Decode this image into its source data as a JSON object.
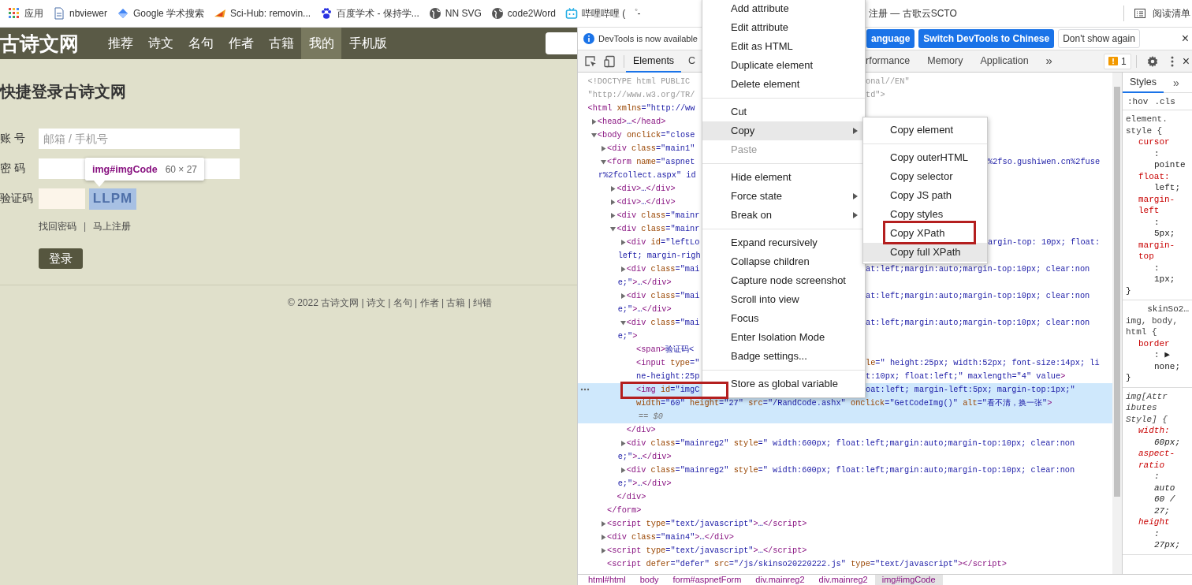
{
  "bookmarks_bar": {
    "items": [
      {
        "label": "应用"
      },
      {
        "label": "nbviewer"
      },
      {
        "label": "Google 学术搜索"
      },
      {
        "label": "Sci-Hub: removin..."
      },
      {
        "label": "百度学术 - 保持学..."
      },
      {
        "label": "NN SVG"
      },
      {
        "label": "code2Word"
      },
      {
        "label": "哔哩哔哩 ( ゜-"
      }
    ],
    "right_items": [
      {
        "label": "注册 — 古歌云SCTO"
      }
    ],
    "reading_list": {
      "label": "阅读清单"
    }
  },
  "web_page": {
    "logo": "古诗文网",
    "nav": [
      {
        "label": "推荐",
        "selected": false
      },
      {
        "label": "诗文",
        "selected": false
      },
      {
        "label": "名句",
        "selected": false
      },
      {
        "label": "作者",
        "selected": false
      },
      {
        "label": "古籍",
        "selected": false
      },
      {
        "label": "我的",
        "selected": true
      },
      {
        "label": "手机版",
        "selected": false
      }
    ],
    "title": "快捷登录古诗文网",
    "fields": [
      {
        "kind": "text",
        "label": "账 号",
        "placeholder": "邮箱 / 手机号"
      },
      {
        "kind": "password",
        "label": "密 码"
      },
      {
        "kind": "captcha",
        "label": "验证码",
        "captcha": "LLPM",
        "highlighted": true
      }
    ],
    "links": [
      "找回密码",
      "马上注册"
    ],
    "link_separator": "|",
    "submit": "登录",
    "footer": "© 2022 古诗文网 | 诗文 | 名句 | 作者 | 古籍 | 纠错",
    "tooltip": {
      "selector": "img#imgCode",
      "size": "60 × 27"
    }
  },
  "devtools": {
    "infobar": {
      "message": "DevTools is now available",
      "buttons": [
        {
          "kind": "primary",
          "label": "anguage"
        },
        {
          "kind": "primary",
          "label": "Switch DevTools to Chinese"
        },
        {
          "kind": "plain",
          "label": "Don't show again"
        }
      ],
      "close": "×"
    },
    "tabs": [
      {
        "label": "Elements",
        "selected": true
      },
      {
        "label": "C",
        "selected": false
      }
    ],
    "tabs_right": [
      {
        "label": "rformance",
        "selected": false
      },
      {
        "label": "Memory",
        "selected": false
      },
      {
        "label": "Application",
        "selected": false
      }
    ],
    "more_tabs": "»",
    "issues_count": "1",
    "close": "×",
    "dom_tree": [
      {
        "doctype": true,
        "selected": false,
        "annotated": false,
        "lines": [
          {
            "text": "<!DOCTYPE html PUBLIC",
            "right": {
              "text": "onal//EN\"",
              "beside_submenu": false
            }
          },
          {
            "text": "\"http://www.w3.org/TR/",
            "right": {
              "text": "td\">",
              "beside_submenu": false
            }
          }
        ]
      },
      {
        "selected": false,
        "annotated": false,
        "lines": [
          {
            "text": "<html xmlns=\"http://ww"
          }
        ],
        "children": [
          {
            "expanded": false,
            "selected": false,
            "annotated": false,
            "lines": [
              {
                "text": "<head>…</head>"
              }
            ]
          },
          {
            "expanded": true,
            "selected": false,
            "annotated": false,
            "lines": [
              {
                "text": "<body onclick=\"close"
              }
            ],
            "children": [
              {
                "expanded": false,
                "selected": false,
                "annotated": false,
                "lines": [
                  {
                    "text": "<div class=\"main1\""
                  }
                ]
              },
              {
                "expanded": true,
                "selected": false,
                "annotated": false,
                "lines": [
                  {
                    "text": "<form name=\"aspnet",
                    "right": {
                      "text": "%2fso.gushiwen.cn%2fuse",
                      "beside_submenu": true
                    }
                  },
                  {
                    "text": "r%2fcollect.aspx\" id"
                  }
                ],
                "close": "</form>",
                "children": [
                  {
                    "expanded": false,
                    "selected": false,
                    "annotated": false,
                    "lines": [
                      {
                        "text": "<div>…</div>"
                      }
                    ]
                  },
                  {
                    "expanded": false,
                    "selected": false,
                    "annotated": false,
                    "lines": [
                      {
                        "text": "<div>…</div>"
                      }
                    ]
                  },
                  {
                    "expanded": false,
                    "selected": false,
                    "annotated": false,
                    "lines": [
                      {
                        "text": "<div class=\"mainr"
                      }
                    ]
                  },
                  {
                    "expanded": true,
                    "selected": false,
                    "annotated": false,
                    "lines": [
                      {
                        "text": "<div class=\"mainr"
                      }
                    ],
                    "close": "</div>",
                    "children": [
                      {
                        "expanded": false,
                        "selected": false,
                        "annotated": false,
                        "lines": [
                          {
                            "text": "<div id=\"leftLo",
                            "right": {
                              "text": "argin-top: 10px; float:",
                              "beside_submenu": true
                            }
                          },
                          {
                            "text": "left; margin-righ"
                          }
                        ]
                      },
                      {
                        "expanded": false,
                        "selected": false,
                        "annotated": false,
                        "lines": [
                          {
                            "text": "<div class=\"mai",
                            "right": {
                              "text": "at:left;margin:auto;margin-top:10px; clear:non",
                              "beside_submenu": false
                            }
                          },
                          {
                            "text": "e;\">…</div>"
                          }
                        ]
                      },
                      {
                        "expanded": false,
                        "selected": false,
                        "annotated": false,
                        "lines": [
                          {
                            "text": "<div class=\"mai",
                            "right": {
                              "text": "at:left;margin:auto;margin-top:10px; clear:non",
                              "beside_submenu": false
                            }
                          },
                          {
                            "text": "e;\">…</div>"
                          }
                        ]
                      },
                      {
                        "expanded": true,
                        "selected": false,
                        "annotated": false,
                        "lines": [
                          {
                            "text": "<div class=\"mai",
                            "right": {
                              "text": "at:left;margin:auto;margin-top:10px; clear:non",
                              "beside_submenu": false
                            }
                          },
                          {
                            "text": "e;\">"
                          }
                        ],
                        "close": "</div>",
                        "children": [
                          {
                            "selected": false,
                            "annotated": false,
                            "lines": [
                              {
                                "text": "<span>验证码<"
                              }
                            ]
                          },
                          {
                            "selected": false,
                            "annotated": false,
                            "lines": [
                              {
                                "text": "<input type=\"",
                                "right": {
                                  "text": "le=\" height:25px; width:52px; font-size:14px; li",
                                  "beside_submenu": false
                                }
                              },
                              {
                                "text": "ne-height:25p",
                                "right": {
                                  "text": "t:10px; float:left;\" maxlength=\"4\" value>",
                                  "beside_submenu": false
                                }
                              }
                            ]
                          },
                          {
                            "selected": true,
                            "annotated": true,
                            "console_ref": "== $0",
                            "lines": [
                              {
                                "text": "<img id=\"imgC",
                                "right": {
                                  "text": "oat:left; margin-left:5px; margin-top:1px;\"",
                                  "beside_submenu": false
                                }
                              },
                              {
                                "text": "width=\"60\" height=\"27\" src=\"/RandCode.ashx\" onclick=\"GetCodeImg()\" alt=\"看不清，换一张\">"
                              }
                            ]
                          }
                        ]
                      },
                      {
                        "expanded": false,
                        "selected": false,
                        "annotated": false,
                        "lines": [
                          {
                            "text": "<div class=\"mainreg2\" style=\" width:600px; float:left;margin:auto;margin-top:10px; clear:non"
                          },
                          {
                            "text": "e;\">…</div>"
                          }
                        ]
                      },
                      {
                        "expanded": false,
                        "selected": false,
                        "annotated": false,
                        "lines": [
                          {
                            "text": "<div class=\"mainreg2\" style=\" width:600px; float:left;margin:auto;margin-top:10px; clear:non"
                          },
                          {
                            "text": "e;\">…</div>"
                          }
                        ]
                      }
                    ]
                  }
                ]
              },
              {
                "expanded": false,
                "selected": false,
                "annotated": false,
                "lines": [
                  {
                    "text": "<script type=\"text/javascript\">…</script>"
                  }
                ]
              },
              {
                "expanded": false,
                "selected": false,
                "annotated": false,
                "lines": [
                  {
                    "text": "<div class=\"main4\">…</div>"
                  }
                ]
              },
              {
                "expanded": false,
                "selected": false,
                "annotated": false,
                "lines": [
                  {
                    "text": "<script type=\"text/javascript\">…</script>"
                  }
                ]
              },
              {
                "selected": false,
                "annotated": false,
                "lines": [
                  {
                    "text": "<script defer=\"defer\" src=\"/js/skinso20220222.js\" type=\"text/javascript\"></script>"
                  }
                ]
              }
            ]
          }
        ]
      }
    ],
    "breadcrumbs": [
      {
        "label": "html#html",
        "selected": false
      },
      {
        "label": "body",
        "selected": false
      },
      {
        "label": "form#aspnetForm",
        "selected": false
      },
      {
        "label": "div.mainreg2",
        "selected": false
      },
      {
        "label": "div.mainreg2",
        "selected": false
      },
      {
        "label": "img#imgCode",
        "selected": true
      }
    ],
    "styles_pane": {
      "tabs": [
        {
          "label": "Styles",
          "selected": true
        }
      ],
      "more": "»",
      "filters": [
        ":hov",
        ".cls"
      ],
      "rules": [
        {
          "italic": false,
          "lines": [
            {
              "kind": "selector",
              "text": "element."
            },
            {
              "kind": "selector",
              "text": "style {"
            },
            {
              "kind": "property",
              "text": "cursor"
            },
            {
              "kind": "value",
              "text": ":"
            },
            {
              "kind": "value",
              "text": "pointe"
            },
            {
              "kind": "property",
              "text": "float:"
            },
            {
              "kind": "value",
              "text": "left;"
            },
            {
              "kind": "property",
              "text": "margin-"
            },
            {
              "kind": "property",
              "text": "left"
            },
            {
              "kind": "value",
              "text": ":"
            },
            {
              "kind": "value",
              "text": "5px;"
            },
            {
              "kind": "property",
              "text": "margin-"
            },
            {
              "kind": "property",
              "text": "top"
            },
            {
              "kind": "value",
              "text": ":"
            },
            {
              "kind": "value",
              "text": "1px;"
            },
            {
              "kind": "brace",
              "text": "}"
            }
          ]
        },
        {
          "italic": false,
          "source": "skinSo2…",
          "lines": [
            {
              "kind": "selector",
              "text": "img, body,"
            },
            {
              "kind": "selector",
              "text": "html {"
            },
            {
              "kind": "property",
              "text": "border"
            },
            {
              "kind": "value",
              "text": ": ▶"
            },
            {
              "kind": "value",
              "text": "none;"
            },
            {
              "kind": "brace",
              "text": "}"
            }
          ]
        },
        {
          "italic": true,
          "lines": [
            {
              "kind": "selector",
              "text": "img[Attr"
            },
            {
              "kind": "selector",
              "text": "ibutes"
            },
            {
              "kind": "selector",
              "text": "Style] {"
            },
            {
              "kind": "property",
              "text": "width:"
            },
            {
              "kind": "value",
              "text": "60px;"
            },
            {
              "kind": "property",
              "text": "aspect-"
            },
            {
              "kind": "property",
              "text": "ratio"
            },
            {
              "kind": "value",
              "text": ":"
            },
            {
              "kind": "value",
              "text": "auto"
            },
            {
              "kind": "value",
              "text": "60 /"
            },
            {
              "kind": "value",
              "text": "27;"
            },
            {
              "kind": "property",
              "text": "height"
            },
            {
              "kind": "value",
              "text": ":"
            },
            {
              "kind": "value",
              "text": "27px;"
            }
          ]
        }
      ]
    }
  },
  "context_menu": {
    "groups": [
      [
        {
          "label": "Add attribute",
          "highlighted": false,
          "disabled": false,
          "has_submenu": false,
          "annotated": false
        },
        {
          "label": "Edit attribute",
          "highlighted": false,
          "disabled": false,
          "has_submenu": false,
          "annotated": false
        },
        {
          "label": "Edit as HTML",
          "highlighted": false,
          "disabled": false,
          "has_submenu": false,
          "annotated": false
        },
        {
          "label": "Duplicate element",
          "highlighted": false,
          "disabled": false,
          "has_submenu": false,
          "annotated": false
        },
        {
          "label": "Delete element",
          "highlighted": false,
          "disabled": false,
          "has_submenu": false,
          "annotated": false
        }
      ],
      [
        {
          "label": "Cut",
          "highlighted": false,
          "disabled": false,
          "has_submenu": false,
          "annotated": false
        },
        {
          "label": "Copy",
          "highlighted": true,
          "disabled": false,
          "has_submenu": true,
          "annotated": false
        },
        {
          "label": "Paste",
          "highlighted": false,
          "disabled": true,
          "has_submenu": false,
          "annotated": false
        }
      ],
      [
        {
          "label": "Hide element",
          "highlighted": false,
          "disabled": false,
          "has_submenu": false,
          "annotated": false
        },
        {
          "label": "Force state",
          "highlighted": false,
          "disabled": false,
          "has_submenu": true,
          "annotated": false
        },
        {
          "label": "Break on",
          "highlighted": false,
          "disabled": false,
          "has_submenu": true,
          "annotated": false
        }
      ],
      [
        {
          "label": "Expand recursively",
          "highlighted": false,
          "disabled": false,
          "has_submenu": false,
          "annotated": false
        },
        {
          "label": "Collapse children",
          "highlighted": false,
          "disabled": false,
          "has_submenu": false,
          "annotated": false
        },
        {
          "label": "Capture node screenshot",
          "highlighted": false,
          "disabled": false,
          "has_submenu": false,
          "annotated": false
        },
        {
          "label": "Scroll into view",
          "highlighted": false,
          "disabled": false,
          "has_submenu": false,
          "annotated": false
        },
        {
          "label": "Focus",
          "highlighted": false,
          "disabled": false,
          "has_submenu": false,
          "annotated": false
        },
        {
          "label": "Enter Isolation Mode",
          "highlighted": false,
          "disabled": false,
          "has_submenu": false,
          "annotated": false
        },
        {
          "label": "Badge settings...",
          "highlighted": false,
          "disabled": false,
          "has_submenu": false,
          "annotated": false
        }
      ],
      [
        {
          "label": "Store as global variable",
          "highlighted": false,
          "disabled": false,
          "has_submenu": false,
          "annotated": false
        }
      ]
    ]
  },
  "submenu": {
    "groups": [
      [
        {
          "label": "Copy element",
          "highlighted": false,
          "disabled": false,
          "has_submenu": false,
          "annotated": false
        }
      ],
      [
        {
          "label": "Copy outerHTML",
          "highlighted": false,
          "disabled": false,
          "has_submenu": false,
          "annotated": false
        },
        {
          "label": "Copy selector",
          "highlighted": false,
          "disabled": false,
          "has_submenu": false,
          "annotated": false
        },
        {
          "label": "Copy JS path",
          "highlighted": false,
          "disabled": false,
          "has_submenu": false,
          "annotated": false
        },
        {
          "label": "Copy styles",
          "highlighted": false,
          "disabled": false,
          "has_submenu": false,
          "annotated": false
        },
        {
          "label": "Copy XPath",
          "highlighted": false,
          "disabled": false,
          "has_submenu": false,
          "annotated": true
        },
        {
          "label": "Copy full XPath",
          "highlighted": true,
          "disabled": false,
          "has_submenu": false,
          "annotated": false
        }
      ]
    ]
  }
}
